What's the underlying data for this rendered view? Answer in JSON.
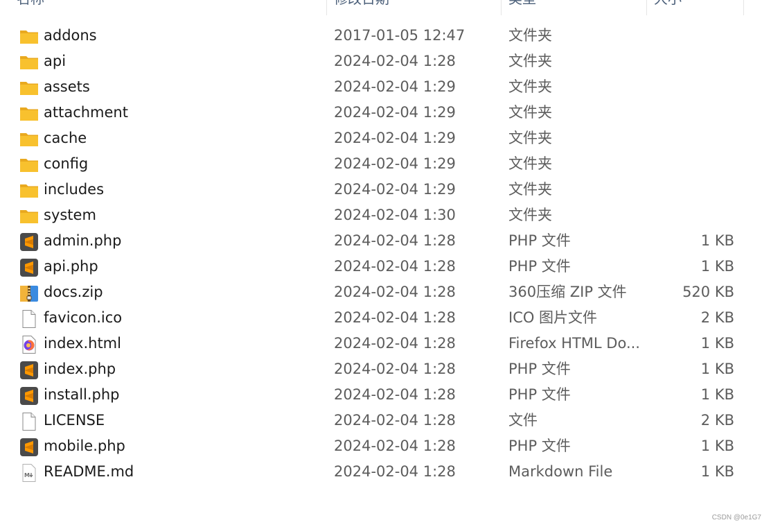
{
  "header": {
    "name": "名称",
    "date": "修改日期",
    "type": "类型",
    "size": "大小"
  },
  "files": [
    {
      "name": "addons",
      "date": "2017-01-05 12:47",
      "type": "文件夹",
      "size": "",
      "icon": "folder-icon"
    },
    {
      "name": "api",
      "date": "2024-02-04 1:28",
      "type": "文件夹",
      "size": "",
      "icon": "folder-icon"
    },
    {
      "name": "assets",
      "date": "2024-02-04 1:29",
      "type": "文件夹",
      "size": "",
      "icon": "folder-icon"
    },
    {
      "name": "attachment",
      "date": "2024-02-04 1:29",
      "type": "文件夹",
      "size": "",
      "icon": "folder-icon"
    },
    {
      "name": "cache",
      "date": "2024-02-04 1:29",
      "type": "文件夹",
      "size": "",
      "icon": "folder-icon"
    },
    {
      "name": "config",
      "date": "2024-02-04 1:29",
      "type": "文件夹",
      "size": "",
      "icon": "folder-icon"
    },
    {
      "name": "includes",
      "date": "2024-02-04 1:29",
      "type": "文件夹",
      "size": "",
      "icon": "folder-icon"
    },
    {
      "name": "system",
      "date": "2024-02-04 1:30",
      "type": "文件夹",
      "size": "",
      "icon": "folder-icon"
    },
    {
      "name": "admin.php",
      "date": "2024-02-04 1:28",
      "type": "PHP 文件",
      "size": "1 KB",
      "icon": "sublime-text-icon"
    },
    {
      "name": "api.php",
      "date": "2024-02-04 1:28",
      "type": "PHP 文件",
      "size": "1 KB",
      "icon": "sublime-text-icon"
    },
    {
      "name": "docs.zip",
      "date": "2024-02-04 1:28",
      "type": "360压缩 ZIP 文件",
      "size": "520 KB",
      "icon": "zip-archive-icon"
    },
    {
      "name": "favicon.ico",
      "date": "2024-02-04 1:28",
      "type": "ICO 图片文件",
      "size": "2 KB",
      "icon": "blank-file-icon"
    },
    {
      "name": "index.html",
      "date": "2024-02-04 1:28",
      "type": "Firefox HTML Do...",
      "size": "1 KB",
      "icon": "firefox-html-icon"
    },
    {
      "name": "index.php",
      "date": "2024-02-04 1:28",
      "type": "PHP 文件",
      "size": "1 KB",
      "icon": "sublime-text-icon"
    },
    {
      "name": "install.php",
      "date": "2024-02-04 1:28",
      "type": "PHP 文件",
      "size": "1 KB",
      "icon": "sublime-text-icon"
    },
    {
      "name": "LICENSE",
      "date": "2024-02-04 1:28",
      "type": "文件",
      "size": "2 KB",
      "icon": "blank-file-icon"
    },
    {
      "name": "mobile.php",
      "date": "2024-02-04 1:28",
      "type": "PHP 文件",
      "size": "1 KB",
      "icon": "sublime-text-icon"
    },
    {
      "name": "README.md",
      "date": "2024-02-04 1:28",
      "type": "Markdown File",
      "size": "1 KB",
      "icon": "markdown-file-icon"
    }
  ],
  "watermark": "CSDN @0e1G7",
  "colors": {
    "folder": "#f8c12e",
    "folder_back": "#e9a91f",
    "sublime_bg": "#4a4a4a",
    "sublime_accent": "#ff9800",
    "header_text": "#4c607a"
  }
}
